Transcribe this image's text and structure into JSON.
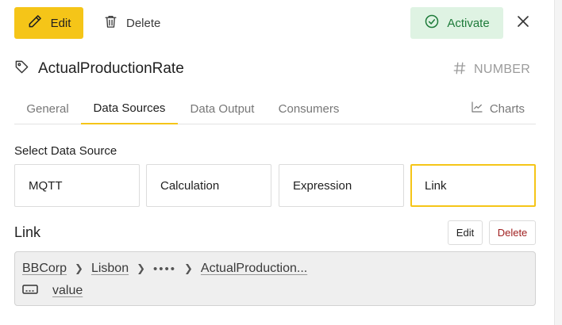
{
  "toolbar": {
    "edit_label": "Edit",
    "delete_label": "Delete",
    "activate_label": "Activate"
  },
  "title": {
    "name": "ActualProductionRate",
    "type_label": "NUMBER"
  },
  "tabs": [
    {
      "label": "General"
    },
    {
      "label": "Data Sources"
    },
    {
      "label": "Data Output"
    },
    {
      "label": "Consumers"
    }
  ],
  "charts_tab_label": "Charts",
  "select_source": {
    "label": "Select Data Source",
    "options": [
      "MQTT",
      "Calculation",
      "Expression",
      "Link"
    ],
    "selected": "Link"
  },
  "link": {
    "title": "Link",
    "edit_label": "Edit",
    "delete_label": "Delete",
    "breadcrumb": [
      "BBCorp",
      "Lisbon",
      "••••",
      "ActualProduction..."
    ],
    "field": "value"
  },
  "colors": {
    "accent": "#f5c518",
    "activate_bg": "#dff3e3",
    "activate_fg": "#1e7b3a",
    "danger": "#a02020"
  },
  "icons": {
    "edit": "pencil-icon",
    "delete": "trash-icon",
    "activate": "check-circle-icon",
    "close": "close-icon",
    "tag": "tag-icon",
    "type": "hash-icon",
    "charts": "chart-icon",
    "field": "field-icon"
  }
}
